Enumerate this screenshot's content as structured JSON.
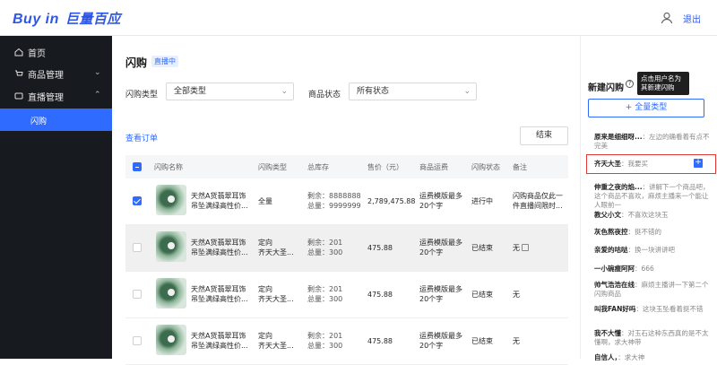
{
  "header": {
    "logo_en": "Buy in",
    "logo_cn": "巨量百应",
    "logout": "退出"
  },
  "sidebar": {
    "items": [
      {
        "label": "首页",
        "icon": "home-icon"
      },
      {
        "label": "商品管理",
        "icon": "cart-icon",
        "chevron": "⌄"
      },
      {
        "label": "直播管理",
        "icon": "live-icon",
        "chevron": "⌃"
      },
      {
        "label": "闪购",
        "active": true
      }
    ]
  },
  "main": {
    "title": "闪购",
    "badge": "直播中",
    "filter_type_label": "闪购类型",
    "filter_type_value": "全部类型",
    "filter_status_label": "商品状态",
    "filter_status_value": "所有状态",
    "view_orders": "查看订单",
    "end_button": "结束",
    "columns": [
      "闪购名称",
      "闪购类型",
      "总库存",
      "售价（元）",
      "商品运费",
      "闪购状态",
      "备注"
    ],
    "rows": [
      {
        "name1": "天然A货翡翠耳饰",
        "name2": "吊坠满绿高性价...",
        "type1": "全量",
        "type2": "",
        "stock1": "剩余：8888888",
        "stock2": "总量：9999999",
        "price": "2,789,475.88",
        "ship1": "运费模版最多",
        "ship2": "20个字",
        "status": "进行中",
        "note1": "闪购商品仅此一",
        "note2": "件直播间限时...",
        "checked": true
      },
      {
        "name1": "天然A货翡翠耳饰",
        "name2": "吊坠满绿高性价...",
        "type1": "定向",
        "type2": "齐天大圣...",
        "stock1": "剩余：201",
        "stock2": "总量：300",
        "price": "475.88",
        "ship1": "运费模版最多",
        "ship2": "20个字",
        "status": "已结束",
        "note1": "无",
        "note2": ""
      },
      {
        "name1": "天然A货翡翠耳饰",
        "name2": "吊坠满绿高性价...",
        "type1": "定向",
        "type2": "齐天大圣...",
        "stock1": "剩余：201",
        "stock2": "总量：300",
        "price": "475.88",
        "ship1": "运费模版最多",
        "ship2": "20个字",
        "status": "已结束",
        "note1": "无",
        "note2": ""
      },
      {
        "name1": "天然A货翡翠耳饰",
        "name2": "吊坠满绿高性价...",
        "type1": "定向",
        "type2": "齐天大圣...",
        "stock1": "剩余：201",
        "stock2": "总量：300",
        "price": "475.88",
        "ship1": "运费模版最多",
        "ship2": "20个字",
        "status": "已结束",
        "note1": "无",
        "note2": ""
      }
    ]
  },
  "panel": {
    "title": "新建闪购",
    "tooltip": "点击用户名为其新建闪购",
    "add_type": "+ 全量类型",
    "comments": [
      {
        "user": "原来是细细呀...",
        "text": "：左边的确看着有点不完美"
      },
      {
        "user": "齐天大圣",
        "text": "：我要买"
      },
      {
        "user": "伸重之夜的焰...",
        "text": "：讲解下一个商品吧，这个商品不喜欢，麻烦主播来一个能让人眼前一"
      },
      {
        "user": "教父小文",
        "text": "：不喜欢这块玉"
      },
      {
        "user": "灰色熬夜控",
        "text": "：挺不错的"
      },
      {
        "user": "亲爱的咕哒",
        "text": "：换一块讲讲吧"
      },
      {
        "user": "一小碗瘦阿阿",
        "text": "：666"
      },
      {
        "user": "帅气浩浩在线",
        "text": "：麻烦主播讲一下第二个闪购商品"
      },
      {
        "user": "叫我FAN好吗",
        "text": "：这块玉坠看着挺不错"
      },
      {
        "user": "我不大懂",
        "text": "：对玉石这种东西真的是不太懂啊，求大神带"
      },
      {
        "user": "自信人，",
        "text": "：求大神"
      }
    ]
  }
}
